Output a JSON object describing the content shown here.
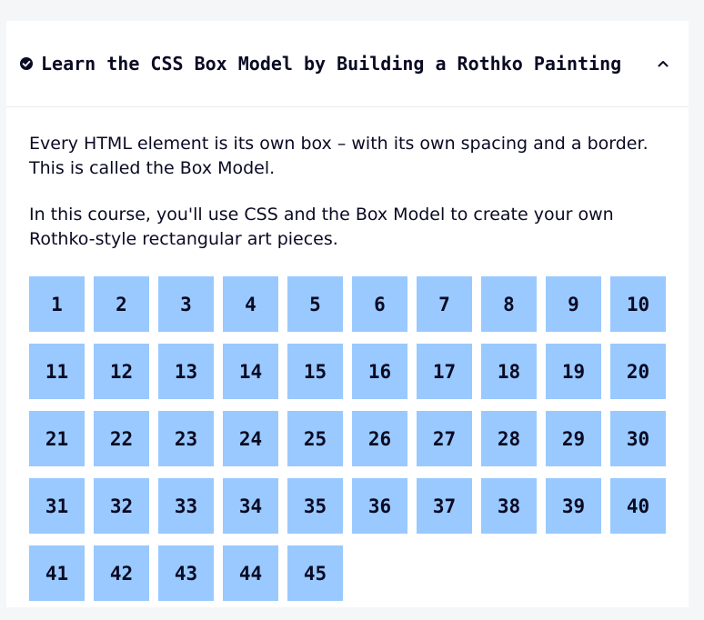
{
  "colors": {
    "page_background": "#f5f6f7",
    "panel_background": "#ffffff",
    "step_background": "#99c9ff",
    "text": "#0a0a23"
  },
  "header": {
    "status_icon": "check-circle-icon",
    "title": "Learn the CSS Box Model by Building a Rothko Painting",
    "toggle_icon": "chevron-up-icon"
  },
  "description": {
    "paragraph_1": "Every HTML element is its own box – with its own spacing and a border. This is called the Box Model.",
    "paragraph_2": "In this course, you'll use CSS and the Box Model to create your own Rothko-style rectangular art pieces."
  },
  "steps": [
    "1",
    "2",
    "3",
    "4",
    "5",
    "6",
    "7",
    "8",
    "9",
    "10",
    "11",
    "12",
    "13",
    "14",
    "15",
    "16",
    "17",
    "18",
    "19",
    "20",
    "21",
    "22",
    "23",
    "24",
    "25",
    "26",
    "27",
    "28",
    "29",
    "30",
    "31",
    "32",
    "33",
    "34",
    "35",
    "36",
    "37",
    "38",
    "39",
    "40",
    "41",
    "42",
    "43",
    "44",
    "45"
  ]
}
